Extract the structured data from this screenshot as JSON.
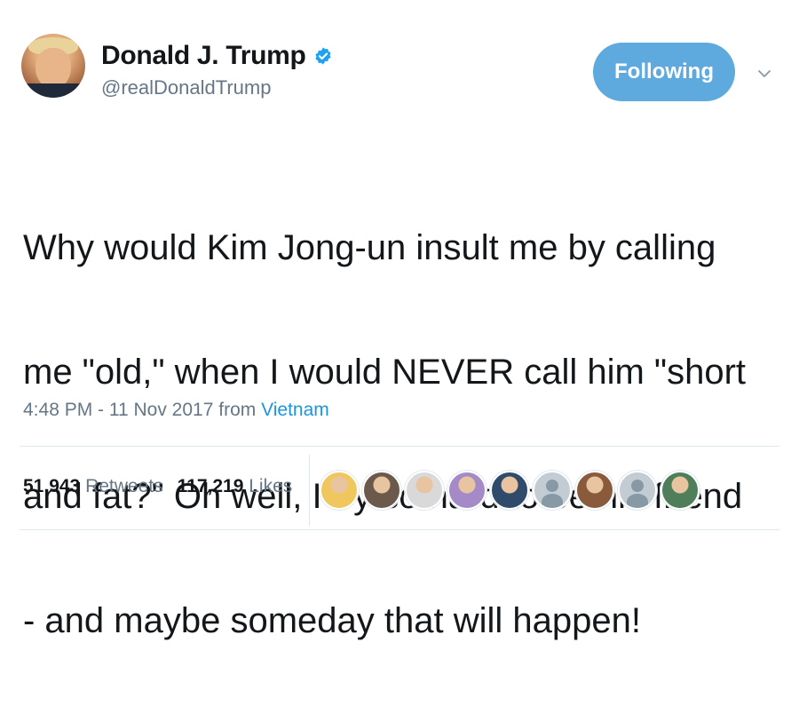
{
  "user": {
    "display_name": "Donald J. Trump",
    "handle": "@realDonaldTrump",
    "verified": true
  },
  "follow_button": {
    "label": "Following",
    "color": "#5ea9dd"
  },
  "tweet": {
    "lines": [
      "Why would Kim Jong-un insult me by calling",
      "me \"old,\" when I would NEVER call him \"short",
      "and fat?\" Oh well, I try so hard to be his friend",
      "- and maybe someday that will happen!"
    ]
  },
  "meta": {
    "time": "4:48 PM - 11 Nov 2017",
    "from_label": "from",
    "source": "Vietnam"
  },
  "stats": {
    "retweets_count": "51,943",
    "retweets_label": "Retweets",
    "likes_count": "117,219",
    "likes_label": "Likes"
  },
  "liker_avatars": [
    {
      "name": "liker-avatar-1",
      "color": "#f0c75e"
    },
    {
      "name": "liker-avatar-2",
      "color": "#6b5a4b"
    },
    {
      "name": "liker-avatar-3",
      "color": "#d9d9d9"
    },
    {
      "name": "liker-avatar-4",
      "color": "#a48bc7"
    },
    {
      "name": "liker-avatar-5",
      "color": "#2f4a6b"
    },
    {
      "name": "liker-avatar-6",
      "color": "default"
    },
    {
      "name": "liker-avatar-7",
      "color": "#8a5a3c"
    },
    {
      "name": "liker-avatar-8",
      "color": "default"
    },
    {
      "name": "liker-avatar-9",
      "color": "#4f7f5a"
    }
  ],
  "colors": {
    "text": "#14171a",
    "secondary": "#657786",
    "link": "#1b95e0",
    "verified": "#1da1f2"
  },
  "icons": {
    "verified": "verified-badge-icon",
    "menu": "chevron-down-icon"
  }
}
